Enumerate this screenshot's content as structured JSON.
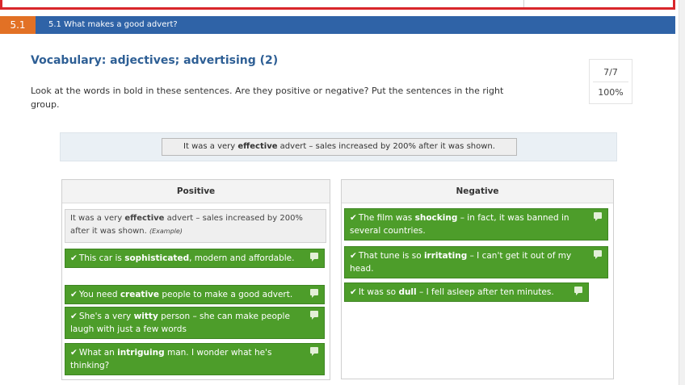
{
  "section": {
    "number": "5.1",
    "title": "5.1 What makes a good advert?"
  },
  "heading": "Vocabulary: adjectives; advertising (2)",
  "instructions": "Look at the words in bold in these sentences. Are they positive or negative? Put the sentences in the right group.",
  "score": {
    "count": "7/7",
    "percent": "100%"
  },
  "source_item": {
    "pre": "It was a very ",
    "bold": "effective",
    "post": " advert – sales increased by 200% after it was shown."
  },
  "positive": {
    "heading": "Positive",
    "example": {
      "pre": "It was a very ",
      "bold": "effective",
      "post": " advert – sales increased by 200% after it was shown.",
      "tag": "(Example)"
    },
    "items": [
      {
        "pre": "This car is ",
        "bold": "sophisticated",
        "post": ", modern and affordable."
      },
      {
        "pre": "You need ",
        "bold": "creative",
        "post": " people to make a good advert."
      },
      {
        "pre": "She's a very ",
        "bold": "witty",
        "post": " person – she can make people laugh with just a few words"
      },
      {
        "pre": "What an ",
        "bold": "intriguing",
        "post": " man. I wonder what he's thinking?"
      }
    ]
  },
  "negative": {
    "heading": "Negative",
    "items": [
      {
        "pre": "The film was ",
        "bold": "shocking",
        "post": " – in fact, it was banned in several countries."
      },
      {
        "pre": "That tune is so ",
        "bold": "irritating",
        "post": " – I can't get it out of my head."
      },
      {
        "pre": "It was so ",
        "bold": "dull",
        "post": " – I fell asleep after ten minutes."
      }
    ]
  },
  "icons": {
    "check": "checkmark-icon",
    "feedback": "speech-bubble-icon"
  },
  "colors": {
    "section_bar": "#2f63a7",
    "section_num": "#e27125",
    "card_green": "#4d9d2a",
    "frame_red": "#d9262b"
  }
}
